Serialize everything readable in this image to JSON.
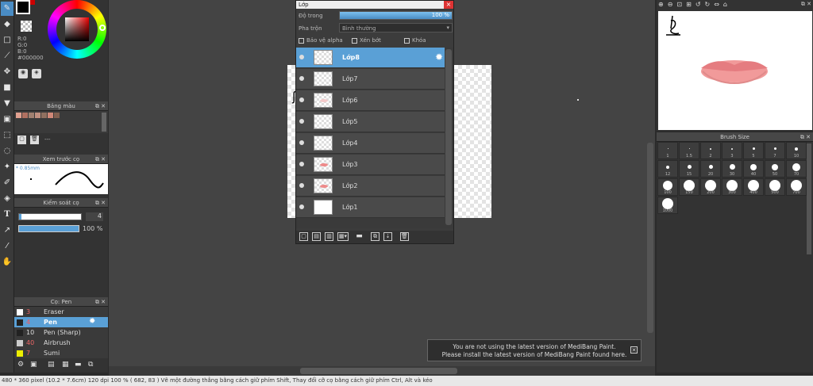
{
  "colors": {
    "accent": "#5aa0d6",
    "fg_color": "#000000",
    "bg_color": "#ffffff"
  },
  "color_values": {
    "r": "R:0",
    "g": "G:0",
    "b": "B:0",
    "hex": "#000000"
  },
  "toolbar": {
    "icons": [
      "pen-icon",
      "eraser-icon",
      "rect-icon",
      "brush-icon",
      "move-icon",
      "fill-rect-icon",
      "bucket-icon",
      "gradient-icon",
      "select-rect-icon",
      "lasso-icon",
      "magic-wand-icon",
      "select-pen-icon",
      "select-eraser-icon",
      "text-icon",
      "operation-icon",
      "eyedropper-icon",
      "hand-icon"
    ]
  },
  "palette_panel": {
    "title": "Bảng màu",
    "extra": "---"
  },
  "brush_preview": {
    "title": "Xem trước cọ",
    "size": "* 0.85mm"
  },
  "brush_control": {
    "title": "Kiểm soát cọ",
    "size_value": "4",
    "opacity_value": "100 %"
  },
  "brush_list": {
    "title": "Cọ: Pen",
    "items": [
      {
        "size": "3",
        "name": "Eraser"
      },
      {
        "size": "4",
        "name": "Pen"
      },
      {
        "size": "10",
        "name": "Pen (Sharp)"
      },
      {
        "size": "40",
        "name": "Airbrush"
      },
      {
        "size": "7",
        "name": "Sumi"
      }
    ]
  },
  "layer_window": {
    "title": "Lớp",
    "opacity_label": "Độ trong",
    "opacity_value": "100 %",
    "opacity": 1.0,
    "blend_label": "Pha trộn",
    "blend_value": "Bình thường",
    "protect_alpha": "Bảo vệ alpha",
    "clipping": "Xén bớt",
    "lock": "Khóa",
    "layers": [
      {
        "name": "Lớp8",
        "selected": true,
        "thumb": "empty"
      },
      {
        "name": "Lớp7",
        "selected": false,
        "thumb": "empty"
      },
      {
        "name": "Lớp6",
        "selected": false,
        "thumb": "faint"
      },
      {
        "name": "Lớp5",
        "selected": false,
        "thumb": "empty"
      },
      {
        "name": "Lớp4",
        "selected": false,
        "thumb": "empty"
      },
      {
        "name": "Lớp3",
        "selected": false,
        "thumb": "lips"
      },
      {
        "name": "Lớp2",
        "selected": false,
        "thumb": "lips"
      },
      {
        "name": "Lớp1",
        "selected": false,
        "thumb": "white"
      }
    ]
  },
  "brush_size_panel": {
    "title": "Brush Size",
    "sizes": [
      "1",
      "1.5",
      "2",
      "3",
      "5",
      "7",
      "10",
      "12",
      "15",
      "20",
      "30",
      "40",
      "50",
      "70",
      "100",
      "150",
      "200",
      "300",
      "400",
      "500",
      "700",
      "1000"
    ]
  },
  "notice": {
    "line1": "You are not using the latest version of MediBang Paint.",
    "line2": "Please install the latest version of MediBang Paint found here."
  },
  "status": {
    "text": "480 * 360 pixel   (10.2 * 7.6cm)   120 dpi   100 %   ( 682, 83 )   Vẽ một đường thẳng bằng cách giữ phím Shift, Thay đổi cỡ cọ bằng cách giữ phím Ctrl, Alt và kéo"
  }
}
